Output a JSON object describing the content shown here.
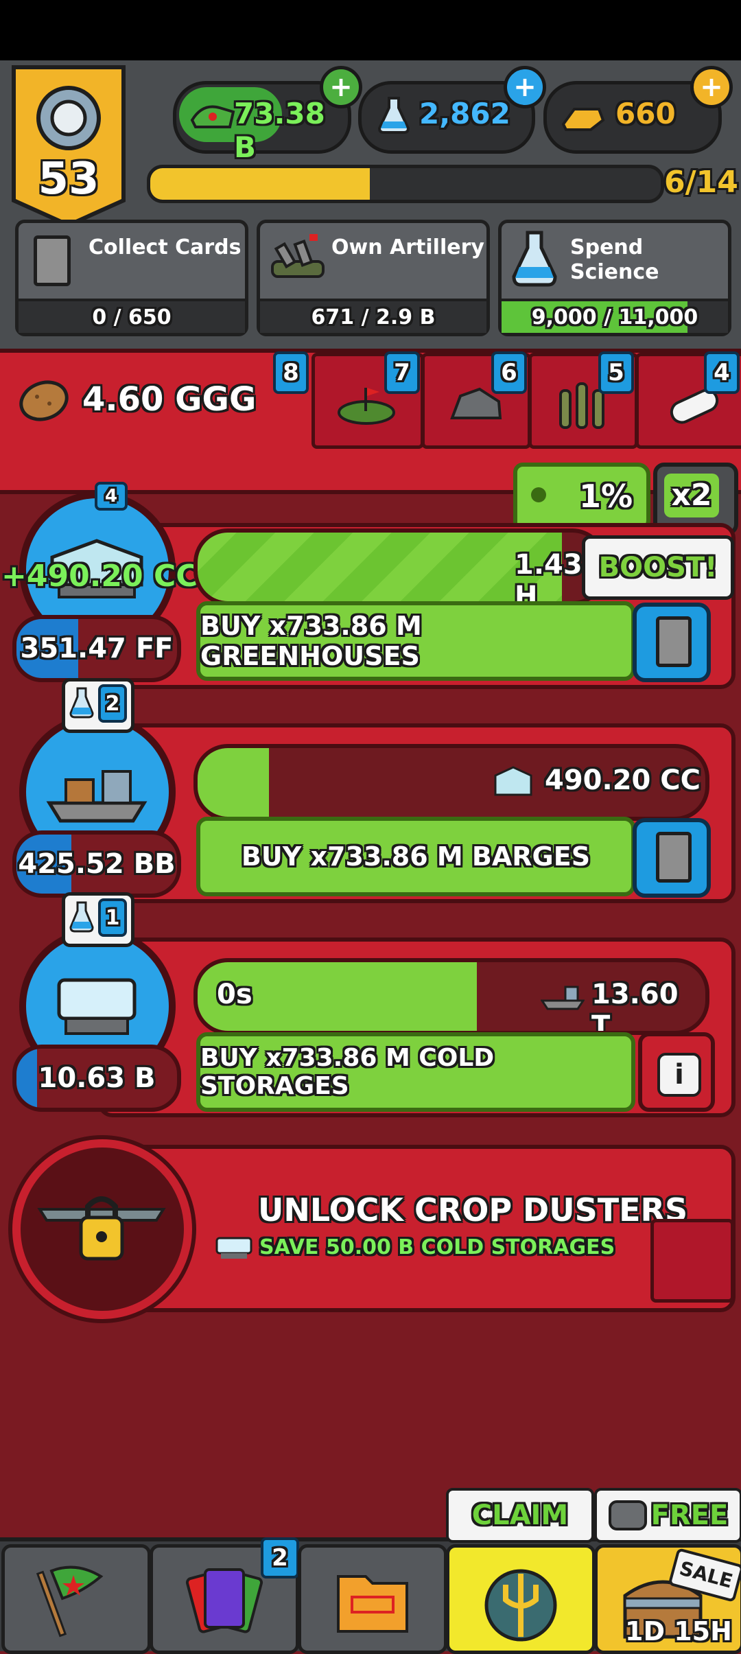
{
  "header": {
    "level": "53",
    "cash": "73.38 B",
    "science": "2,862",
    "gold": "660",
    "progress_text": "6/14",
    "progress_fraction": 0.43
  },
  "goals": [
    {
      "title": "Collect Cards",
      "progress": "0 / 650",
      "fraction": 0.0
    },
    {
      "title": "Own Artillery",
      "progress": "671 / 2.9 B",
      "fraction": 0.0
    },
    {
      "title": "Spend Science",
      "progress": "9,000 / 11,000",
      "fraction": 0.82
    }
  ],
  "resource_panel": {
    "potato_amount": "4.60 GGG",
    "tabs": [
      "8",
      "7",
      "6",
      "5",
      "4"
    ],
    "percent": "1%",
    "multiplier": "x2",
    "boost_label": "BOOST!"
  },
  "producers": [
    {
      "name": "greenhouses",
      "badge": "4",
      "floating_income": "+490.20 CC",
      "owned": "351.47 FF",
      "progress_text": "1.43 H",
      "progress_fraction": 0.9,
      "buy_label": "BUY x733.86 M GREENHOUSES"
    },
    {
      "name": "barges",
      "badge": "2",
      "owned": "425.52 BB",
      "progress_text": "490.20 CC",
      "progress_fraction": 0.14,
      "buy_label": "BUY x733.86 M BARGES"
    },
    {
      "name": "cold-storages",
      "badge": "1",
      "owned": "10.63 B",
      "progress_timer": "0s",
      "progress_text": "13.60 T",
      "progress_fraction": 0.55,
      "buy_label": "BUY x733.86 M COLD STORAGES"
    }
  ],
  "unlock": {
    "title": "UNLOCK CROP DUSTERS",
    "subtitle": "SAVE 50.00 B COLD STORAGES"
  },
  "bottom_nav": {
    "cards_badge": "2",
    "claim_label": "CLAIM",
    "free_label": "FREE",
    "sale_label": "SALE",
    "sale_timer": "1D 15H"
  },
  "colors": {
    "accent_green": "#7ed13e",
    "panel_red": "#c8202e",
    "science_blue": "#2aa3e8",
    "gold": "#f2b428"
  }
}
